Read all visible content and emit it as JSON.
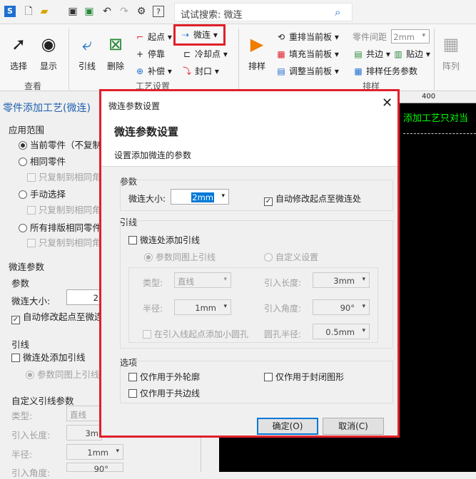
{
  "toolbar": {
    "search_placeholder": "试试搜索: 微连"
  },
  "ribbon": {
    "select": "选择",
    "display": "显示",
    "view_group": "查看",
    "lead": "引线",
    "delete": "删除",
    "start_point": "起点",
    "stop": "停靠",
    "compensate": "补偿",
    "micro_joint": "微连",
    "cooling_point": "冷却点",
    "seal": "封口",
    "process_group": "工艺设置",
    "nest": "排样",
    "re_nest": "重排当前板",
    "fill": "填充当前板",
    "adjust": "调整当前板",
    "common_edge": "共边",
    "stick_edge": "贴边",
    "nest_params": "排样任务参数",
    "part_spacing": "零件间距",
    "part_spacing_value": "2mm",
    "array": "阵列",
    "nest_group": "排样"
  },
  "left_panel": {
    "title": "零件添加工艺(微连)",
    "scope_label": "应用范围",
    "opt_current": "当前零件（不复制",
    "opt_same": "相同零件",
    "copy_same": "只复制到相同角",
    "opt_manual": "手动选择",
    "copy_manual": "只复制到相同角",
    "opt_all": "所有排版相同零件",
    "copy_all": "只复制到相同角",
    "micro_params": "微连参数",
    "params": "参数",
    "size_label": "微连大小:",
    "size_value": "2",
    "auto_move": "自动修改起点至微连",
    "lead": "引线",
    "add_lead": "微连处添加引线",
    "same_as_figure": "参数同图上引线",
    "custom_lead": "自定义引线参数",
    "type_label": "类型:",
    "type_value": "直线",
    "lead_len_label": "引入长度:",
    "lead_len_value": "3m",
    "radius_label": "半径:",
    "radius_value": "1mm",
    "angle_label": "引入角度:",
    "angle_value": "90°"
  },
  "canvas": {
    "hint": "添加工艺只对当",
    "ruler_mark": "400"
  },
  "dialog": {
    "window_title": "微连参数设置",
    "heading": "微连参数设置",
    "subtitle": "设置添加微连的参数",
    "params_group": "参数",
    "size_label": "微连大小:",
    "size_value": "2mm",
    "auto_move": "自动修改起点至微连处",
    "lead_group": "引线",
    "add_lead": "微连处添加引线",
    "same_as_figure": "参数同图上引线",
    "custom": "自定义设置",
    "type_label": "类型:",
    "type_value": "直线",
    "lead_len_label": "引入长度:",
    "lead_len_value": "3mm",
    "radius_label": "半径:",
    "radius_value": "1mm",
    "angle_label": "引入角度:",
    "angle_value": "90°",
    "small_hole": "在引入线起点添加小圆孔",
    "hole_radius_label": "圆孔半径:",
    "hole_radius_value": "0.5mm",
    "options_group": "选项",
    "outer_only": "仅作用于外轮廓",
    "closed_only": "仅作用于封闭图形",
    "common_only": "仅作用于共边线",
    "ok": "确定(O)",
    "cancel": "取消(C)"
  },
  "colors": {
    "highlight_red": "#e0202a",
    "accent_blue": "#0078d7",
    "canvas_text_green": "#00ff00"
  }
}
